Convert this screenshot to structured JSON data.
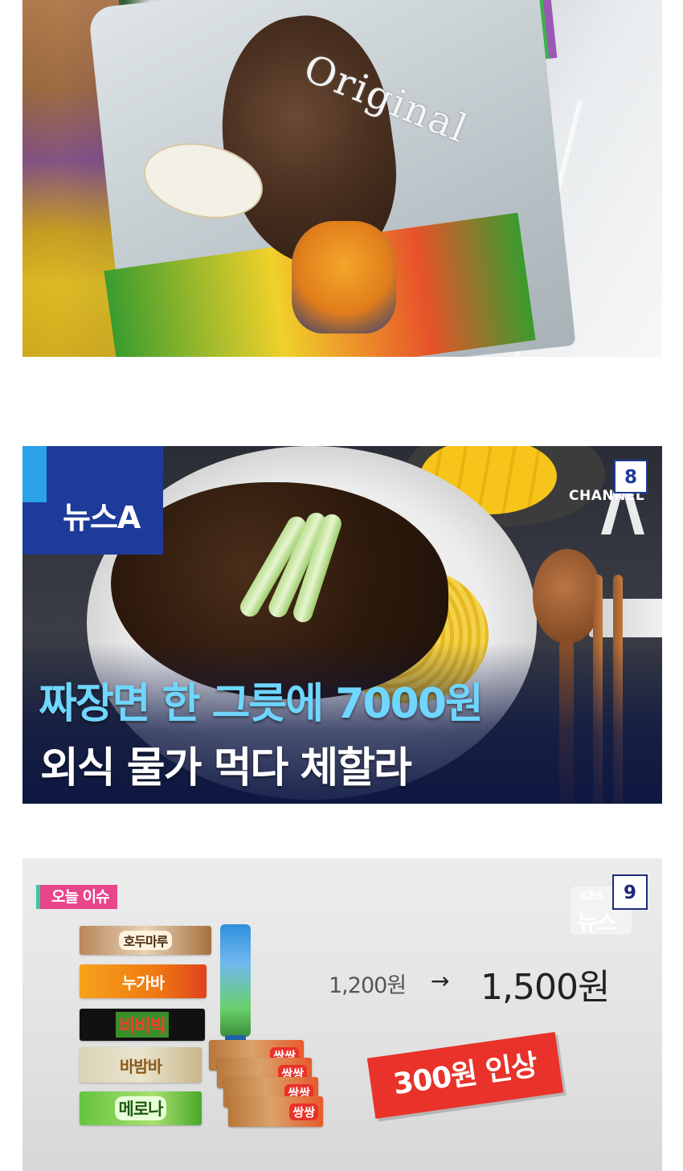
{
  "panel_photo": {
    "package_text": "Original"
  },
  "panel_news": {
    "program_label": "뉴스A",
    "channel_text": "CHANNEL",
    "image_number": "8",
    "headline_line1": "짜장면 한 그릇에 7000원",
    "headline_line2": "외식 물가 먹다 체할라"
  },
  "panel_icecream": {
    "issue_tag": "오늘 이슈",
    "broadcaster_small": "KBS",
    "broadcaster_label": "뉴스",
    "image_number": "9",
    "old_price": "1,200원",
    "arrow": "→",
    "new_price": "1,500원",
    "increase_stamp": "300원 인상",
    "products": [
      "호두마루",
      "누가바",
      "비비빅",
      "바밤바",
      "메로나",
      "쌍쌍",
      "쌍쌍",
      "쌍쌍",
      "쌍쌍"
    ]
  }
}
